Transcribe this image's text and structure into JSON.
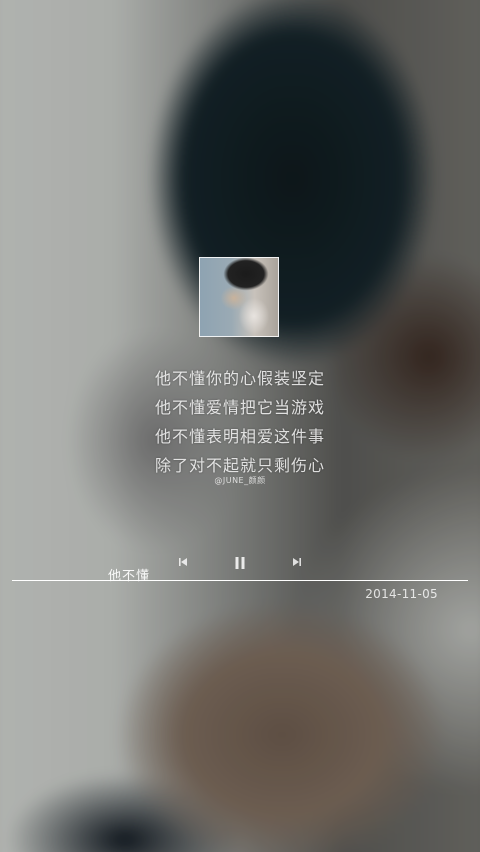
{
  "album": {
    "art_icon": "album-cover-photo"
  },
  "lyrics": {
    "lines": [
      "他不懂你的心假装坚定",
      "他不懂爱情把它当游戏",
      "他不懂表明相爱这件事",
      "除了对不起就只剩伤心"
    ],
    "signature": "@JUNE_颜颜"
  },
  "player": {
    "song_title": "他不懂",
    "prev_icon": "skip-previous-icon",
    "pause_icon": "pause-icon",
    "next_icon": "skip-next-icon",
    "progress": 1.0,
    "date": "2014-11-05"
  }
}
